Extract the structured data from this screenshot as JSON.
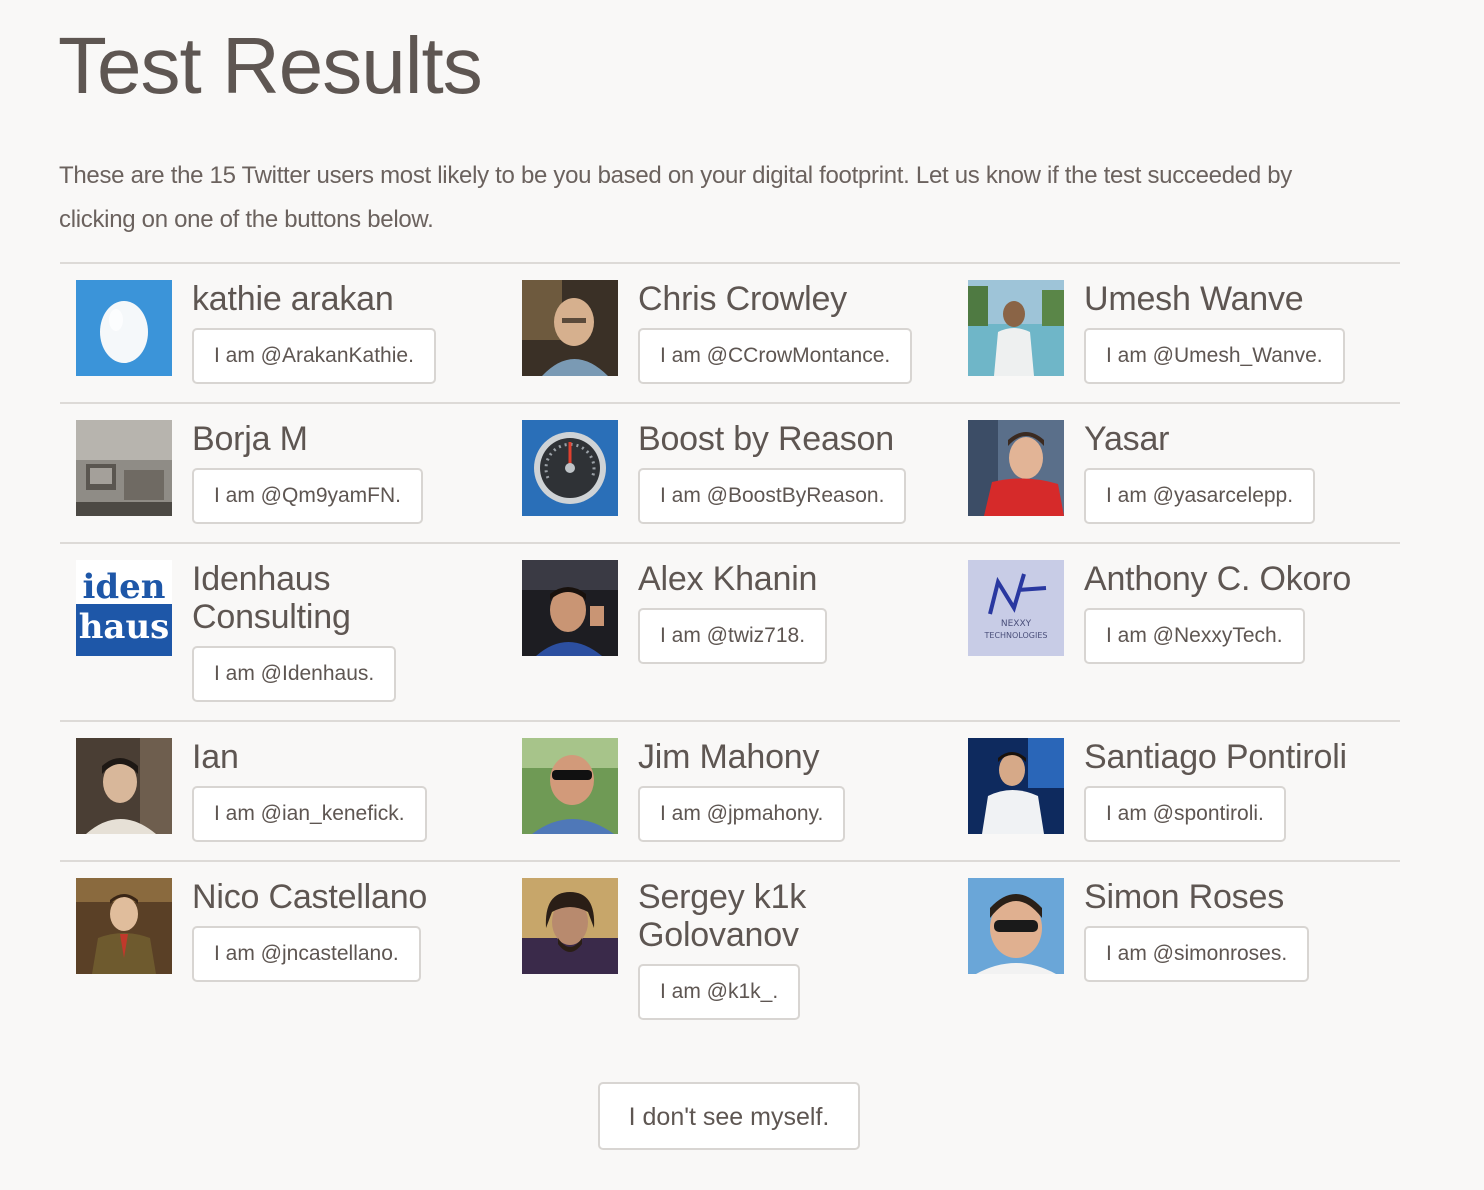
{
  "page": {
    "title": "Test Results",
    "intro": "These are the 15 Twitter users most likely to be you based on your digital footprint. Let us know if the test succeeded by clicking on one of the buttons below."
  },
  "rows": [
    [
      {
        "name": "kathie arakan",
        "button": "I am @ArakanKathie.",
        "avatar": "default-egg-avatar"
      },
      {
        "name": "Chris Crowley",
        "button": "I am @CCrowMontance.",
        "avatar": "photo-avatar"
      },
      {
        "name": "Umesh Wanve",
        "button": "I am @Umesh_Wanve.",
        "avatar": "photo-avatar"
      }
    ],
    [
      {
        "name": "Borja M",
        "button": "I am @Qm9yamFN.",
        "avatar": "photo-avatar"
      },
      {
        "name": "Boost by Reason",
        "button": "I am @BoostByReason.",
        "avatar": "speedometer-avatar"
      },
      {
        "name": "Yasar",
        "button": "I am @yasarcelepp.",
        "avatar": "photo-avatar"
      }
    ],
    [
      {
        "name": "Idenhaus Consulting",
        "button": "I am @Idenhaus.",
        "avatar": "logo-avatar",
        "logo_line1": "iden",
        "logo_line2": "haus"
      },
      {
        "name": "Alex Khanin",
        "button": "I am @twiz718.",
        "avatar": "photo-avatar"
      },
      {
        "name": "Anthony C. Okoro",
        "button": "I am @NexxyTech.",
        "avatar": "logo-avatar",
        "logo_line1": "NEXXY",
        "logo_line2": "TECHNOLOGIES"
      }
    ],
    [
      {
        "name": "Ian",
        "button": "I am @ian_kenefick.",
        "avatar": "photo-avatar"
      },
      {
        "name": "Jim Mahony",
        "button": "I am @jpmahony.",
        "avatar": "photo-avatar"
      },
      {
        "name": "Santiago Pontiroli",
        "button": "I am @spontiroli.",
        "avatar": "photo-avatar"
      }
    ],
    [
      {
        "name": "Nico Castellano",
        "button": "I am @jncastellano.",
        "avatar": "photo-avatar"
      },
      {
        "name": "Sergey k1k Golovanov",
        "button": "I am @k1k_.",
        "avatar": "photo-avatar"
      },
      {
        "name": "Simon Roses",
        "button": "I am @simonroses.",
        "avatar": "photo-avatar"
      }
    ]
  ],
  "footer": {
    "no_match_label": "I don't see myself."
  }
}
